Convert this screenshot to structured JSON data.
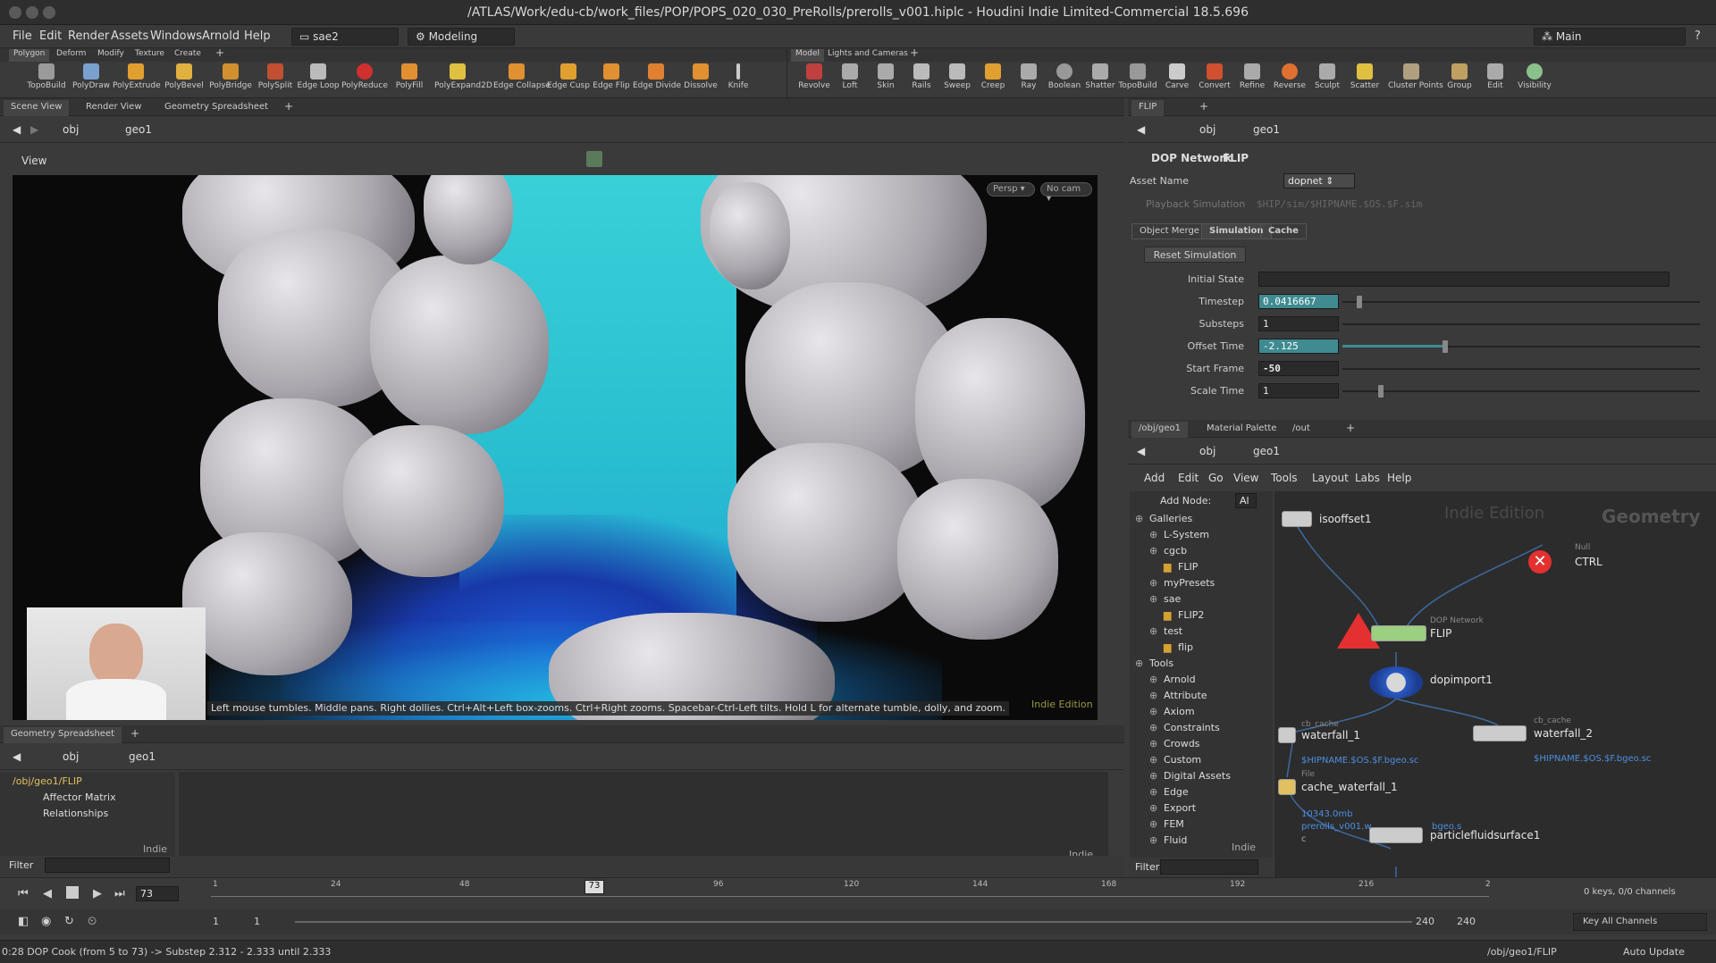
{
  "window": {
    "title": "/ATLAS/Work/edu-cb/work_files/POP/POPS_020_030_PreRolls/prerolls_v001.hiplc - Houdini Indie Limited-Commercial 18.5.696"
  },
  "menu": [
    "File",
    "Edit",
    "Render",
    "Assets",
    "Windows",
    "Arnold",
    "Help"
  ],
  "desktop": "sae2",
  "desktop_mode": "Modeling",
  "main_label": "Main",
  "shelf_left": {
    "tabs": [
      "Polygon",
      "Deform",
      "Modify",
      "Texture",
      "Create"
    ],
    "tools": [
      "TopoBuild",
      "PolyDraw",
      "PolyExtrude",
      "PolyBevel",
      "PolyBridge",
      "PolySplit",
      "Edge Loop",
      "PolyReduce",
      "PolyFill",
      "PolyExpand2D",
      "Edge Collapse",
      "Edge Cusp",
      "Edge Flip",
      "Edge Divide",
      "Dissolve",
      "Knife"
    ]
  },
  "shelf_right": {
    "tabs": [
      "Model",
      "Lights and Cameras"
    ],
    "tools": [
      "Revolve",
      "Loft",
      "Skin",
      "Rails",
      "Sweep",
      "Creep",
      "Ray",
      "Boolean",
      "Shatter",
      "TopoBuild",
      "Carve",
      "Convert",
      "Refine",
      "Reverse",
      "Sculpt",
      "Scatter",
      "Cluster Points",
      "Group",
      "Edit",
      "Visibility"
    ]
  },
  "scene": {
    "tabs": [
      "Scene View",
      "Render View",
      "Geometry Spreadsheet"
    ],
    "path": [
      "obj",
      "geo1"
    ],
    "view_label": "View",
    "persp": "Persp",
    "cam": "No cam",
    "watermark": "Indie Edition",
    "hint": "Left mouse tumbles. Middle pans. Right dollies. Ctrl+Alt+Left box-zooms. Ctrl+Right zooms. Spacebar-Ctrl-Left tilts. Hold L for alternate tumble, dolly, and zoom."
  },
  "spreadsheet": {
    "tab": "Geometry Spreadsheet",
    "path": [
      "obj",
      "geo1"
    ],
    "tree": [
      "/obj/geo1/FLIP",
      "Affector Matrix",
      "Relationships"
    ],
    "indie": "Indie",
    "filter": "Filter"
  },
  "params": {
    "tab": "FLIP",
    "path": [
      "obj",
      "geo1"
    ],
    "type": "DOP Network",
    "name": "FLIP",
    "asset_label": "Asset Name",
    "asset_value": "dopnet",
    "playback_label": "Playback Simulation",
    "playback_path": "$HIP/sim/$HIPNAME.$OS.$F.sim",
    "tabs": [
      "Object Merge",
      "Simulation",
      "Cache"
    ],
    "reset": "Reset Simulation",
    "rows": [
      {
        "label": "Initial State",
        "value": ""
      },
      {
        "label": "Timestep",
        "value": "0.0416667"
      },
      {
        "label": "Substeps",
        "value": "1"
      },
      {
        "label": "Offset Time",
        "value": "-2.125"
      },
      {
        "label": "Start Frame",
        "value": "-50"
      },
      {
        "label": "Scale Time",
        "value": "1"
      }
    ]
  },
  "network": {
    "tabs": [
      "/obj/geo1",
      "Material Palette",
      "/out"
    ],
    "path": [
      "obj",
      "geo1"
    ],
    "menu": [
      "Add",
      "Edit",
      "Go",
      "View",
      "Tools",
      "Layout",
      "Labs",
      "Help"
    ],
    "add_node": "Add Node:",
    "add_node_value": "Al",
    "tree": [
      {
        "t": "Galleries",
        "d": 0
      },
      {
        "t": "L-System",
        "d": 1
      },
      {
        "t": "cgcb",
        "d": 1
      },
      {
        "t": "FLIP",
        "d": 2
      },
      {
        "t": "myPresets",
        "d": 1
      },
      {
        "t": "sae",
        "d": 1
      },
      {
        "t": "FLIP2",
        "d": 2
      },
      {
        "t": "test",
        "d": 1
      },
      {
        "t": "flip",
        "d": 2
      },
      {
        "t": "Tools",
        "d": 0
      },
      {
        "t": "Arnold",
        "d": 1
      },
      {
        "t": "Attribute",
        "d": 1
      },
      {
        "t": "Axiom",
        "d": 1
      },
      {
        "t": "Constraints",
        "d": 1
      },
      {
        "t": "Crowds",
        "d": 1
      },
      {
        "t": "Custom",
        "d": 1
      },
      {
        "t": "Digital Assets",
        "d": 1
      },
      {
        "t": "Edge",
        "d": 1
      },
      {
        "t": "Export",
        "d": 1
      },
      {
        "t": "FEM",
        "d": 1
      },
      {
        "t": "Fluid",
        "d": 1
      }
    ],
    "indie": "Indie",
    "filter": "Filter",
    "watermark1": "Indie Edition",
    "watermark2": "Geometry",
    "nodes": {
      "isooffset": "isooffset1",
      "null_type": "Null",
      "ctrl": "CTRL",
      "dop_type": "DOP Network",
      "flip": "FLIP",
      "dopimport": "dopimport1",
      "cache1_type": "cb_cache",
      "cache1": "waterfall_1",
      "cache1_path": "$HIPNAME.$OS.$F.bgeo.sc",
      "cache2_type": "cb_cache",
      "cache2": "waterfall_2",
      "cache2_path": "$HIPNAME.$OS.$F.bgeo.sc",
      "file_type": "File",
      "file": "cache_waterfall_1",
      "file_size": "10343.0mb",
      "file_path": "prerolls_v001.w",
      "file_path2": "bgeo.s",
      "file_c": "c",
      "pfs": "particlefluidsurface1"
    }
  },
  "timeline": {
    "frame": "73",
    "ticks": [
      "1",
      "24",
      "48",
      "73",
      "96",
      "120",
      "144",
      "168",
      "192",
      "216",
      "2"
    ],
    "start1": "1",
    "start2": "1",
    "end1": "240",
    "end2": "240",
    "keys": "0 keys, 0/0 channels",
    "keyall": "Key All Channels"
  },
  "status": {
    "msg": "0:28 DOP Cook (from 5 to 73) -> Substep 2.312 - 2.333 until 2.333",
    "path": "/obj/geo1/FLIP",
    "update": "Auto Update"
  }
}
